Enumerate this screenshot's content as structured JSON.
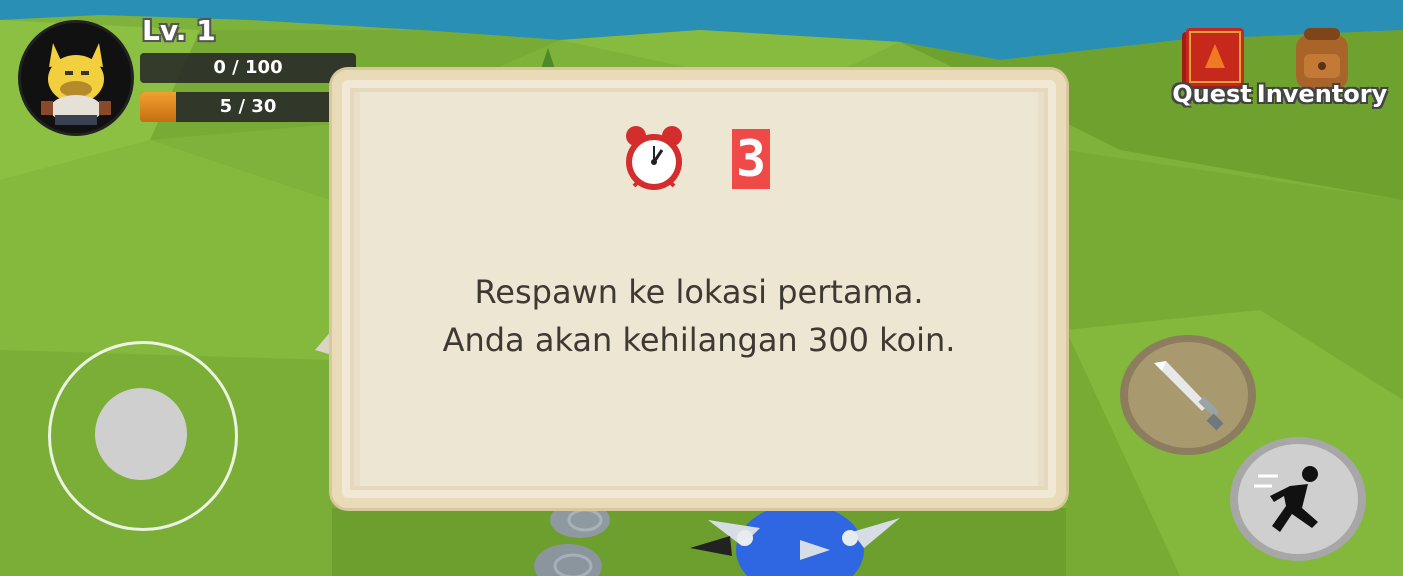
{
  "hud": {
    "level_label": "Lv. 1",
    "xp_text": "0 / 100",
    "xp_fraction": 0.0,
    "energy_text": "5 / 30",
    "energy_fraction": 0.1667,
    "quest_label": "Quest",
    "inventory_label": "Inventory"
  },
  "dialog": {
    "timer_icon": "alarm-clock-icon",
    "countdown": "3",
    "message_line1": "Respawn ke lokasi pertama.",
    "message_line2": "Anda akan kehilangan 300 koin."
  },
  "controls": {
    "attack_icon": "sword-icon",
    "sprint_icon": "running-man-icon"
  },
  "colors": {
    "grass": "#7fb23a",
    "water": "#2a8fb5",
    "dialog_bg": "#ede6d3",
    "countdown_bg": "#ef4a48",
    "bar_fill": "#e38b22"
  }
}
